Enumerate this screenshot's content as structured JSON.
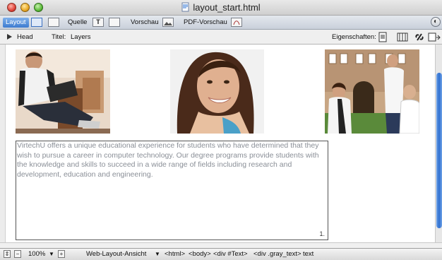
{
  "window": {
    "title": "layout_start.html"
  },
  "toolbar": {
    "layout_label": "Layout",
    "source_label": "Quelle",
    "preview_label": "Vorschau",
    "pdf_preview_label": "PDF-Vorschau"
  },
  "headbar": {
    "head_label": "Head",
    "title_label": "Titel:",
    "title_value": "Layers",
    "properties_label": "Eigenschaften:"
  },
  "content": {
    "body_text": "VirtechU offers a unique educational experience for students who have determined that they wish to pursue a career in computer technology. Our degree programs provide students with the knowledge and skills to succeed in a wide range of fields including research and development, education and engineering.",
    "layer_number": "1."
  },
  "statusbar": {
    "zoom": "100%",
    "view_mode": "Web-Layout-Ansicht",
    "breadcrumb": [
      "<html>",
      "<body>",
      "<div #Text>",
      "<div .gray_text>",
      "text"
    ]
  },
  "colors": {
    "selection": "#3d7bd0",
    "body_text": "#8a8f97"
  },
  "icons": [
    "doc-icon",
    "grid-icon",
    "text-t-icon",
    "split-icon",
    "image-icon",
    "pdf-icon",
    "page-icon",
    "columns-icon",
    "link-icon",
    "panel-icon",
    "triangle-icon"
  ]
}
